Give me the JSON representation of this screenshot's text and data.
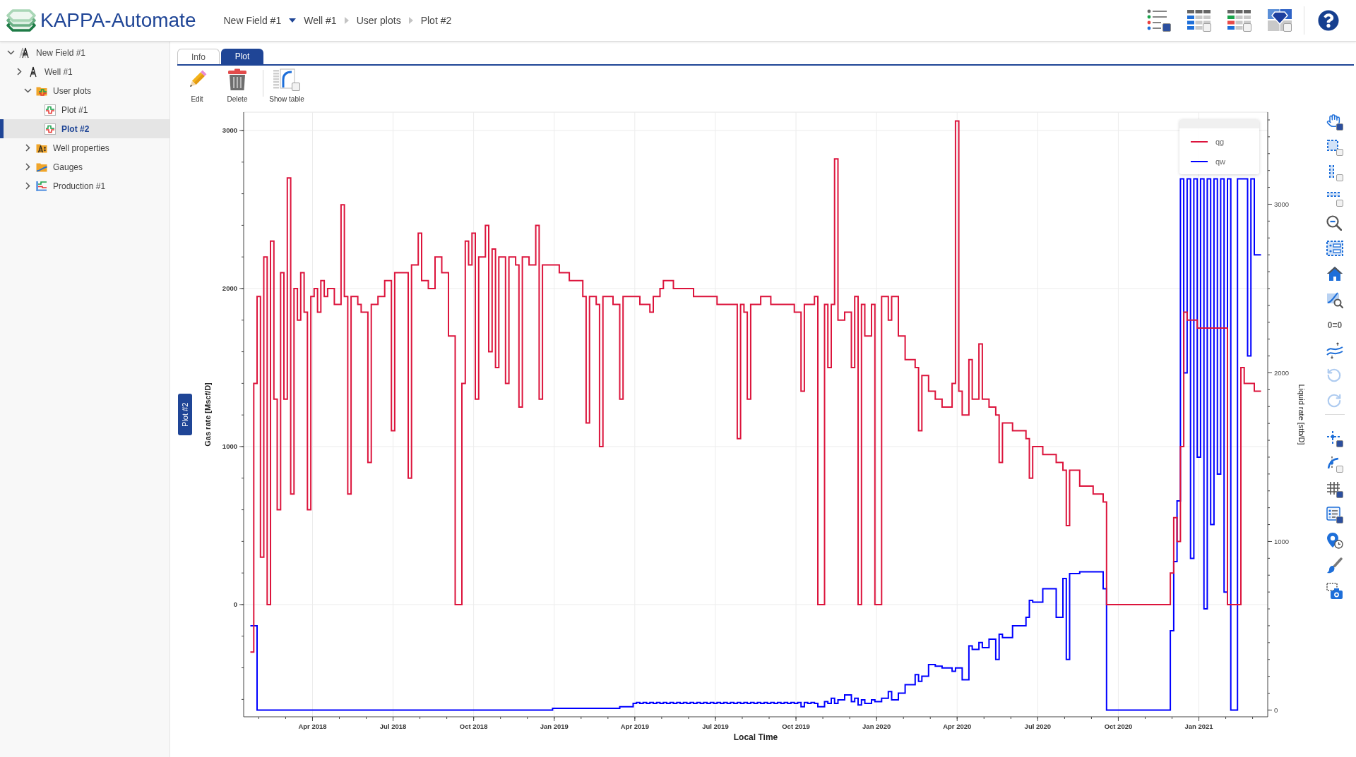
{
  "header": {
    "app_name": "KAPPA-Automate",
    "breadcrumbs": [
      {
        "label": "New Field #1",
        "kind": "dropdown"
      },
      {
        "label": "Well #1",
        "kind": "link"
      },
      {
        "label": "User plots",
        "kind": "link"
      },
      {
        "label": "Plot #2",
        "kind": "current"
      }
    ],
    "view_buttons": [
      {
        "on": true
      },
      {
        "on": false
      },
      {
        "on": false
      },
      {
        "on": false
      }
    ]
  },
  "tree": [
    {
      "label": "New Field #1",
      "kind": "field",
      "expanded": true,
      "selected": false,
      "children": [
        {
          "label": "Well #1",
          "kind": "well",
          "expanded": false,
          "selected": false,
          "children": [
            {
              "label": "User plots",
              "kind": "plotfolder",
              "expanded": true,
              "selected": false,
              "children": [
                {
                  "label": "Plot #1",
                  "kind": "plot",
                  "selected": false
                },
                {
                  "label": "Plot #2",
                  "kind": "plot",
                  "selected": true
                }
              ]
            },
            {
              "label": "Well properties",
              "kind": "propfolder",
              "expanded": false,
              "selected": false
            },
            {
              "label": "Gauges",
              "kind": "gaugefolder",
              "expanded": false,
              "selected": false
            },
            {
              "label": "Production #1",
              "kind": "production",
              "expanded": false,
              "selected": false
            }
          ]
        }
      ]
    }
  ],
  "tabs": [
    {
      "label": "Info",
      "selected": false
    },
    {
      "label": "Plot",
      "selected": true
    }
  ],
  "toolbar": [
    [
      {
        "label": "Edit",
        "kind": "action"
      },
      {
        "label": "Delete",
        "kind": "action"
      }
    ],
    [
      {
        "label": "Show table",
        "kind": "toggle",
        "on": false
      }
    ]
  ],
  "plot": {
    "side_tab": "Plot #2",
    "chart_data": {
      "type": "line",
      "xlabel": "Local Time",
      "ylabel": "Gas rate [Mscf/D]",
      "y2label": "Liquid rate [stb/D]",
      "grid": true,
      "ylim": [
        -710,
        3116
      ],
      "yticks": [
        0,
        1000,
        2000,
        3000
      ],
      "y2lim": [
        -40,
        3546
      ],
      "y2ticks": [
        0,
        1000,
        2000,
        3000
      ],
      "categories": [
        null,
        null,
        null,
        null,
        null,
        null,
        null,
        null,
        null,
        null,
        null,
        null,
        null,
        null,
        null,
        null,
        null,
        null,
        null,
        null,
        "Apr 2018",
        null,
        null,
        null,
        null,
        null,
        null,
        null,
        null,
        null,
        null,
        null,
        null,
        null,
        null,
        null,
        null,
        null,
        null,
        null,
        null,
        null,
        null,
        null,
        "Jul 2018",
        null,
        null,
        null,
        null,
        null,
        null,
        null,
        null,
        null,
        null,
        null,
        null,
        null,
        null,
        null,
        null,
        null,
        null,
        null,
        null,
        null,
        null,
        null,
        "Oct 2018",
        null,
        null,
        null,
        null,
        null,
        null,
        null,
        null,
        null,
        null,
        null,
        null,
        null,
        null,
        null,
        null,
        null,
        null,
        null,
        null,
        null,
        null,
        null,
        "Jan 2019",
        null,
        null,
        null,
        null,
        null,
        null,
        null,
        null,
        null,
        null,
        null,
        null,
        null,
        null,
        null,
        null,
        null,
        null,
        null,
        null,
        null,
        null,
        null,
        "Apr 2019",
        null,
        null,
        null,
        null,
        null,
        null,
        null,
        null,
        null,
        null,
        null,
        null,
        null,
        null,
        null,
        null,
        null,
        null,
        null,
        null,
        null,
        null,
        null,
        "Jul 2019",
        null,
        null,
        null,
        null,
        null,
        null,
        null,
        null,
        null,
        null,
        null,
        null,
        null,
        null,
        null,
        null,
        null,
        null,
        null,
        null,
        null,
        null,
        null,
        "Oct 2019",
        null,
        null,
        null,
        null,
        null,
        null,
        null,
        null,
        null,
        null,
        null,
        null,
        null,
        null,
        null,
        null,
        null,
        null,
        null,
        null,
        null,
        null,
        null,
        "Jan 2020",
        null,
        null,
        null,
        null,
        null,
        null,
        null,
        null,
        null,
        null,
        null,
        null,
        null,
        null,
        null,
        null,
        null,
        null,
        null,
        null,
        null,
        null,
        null,
        "Apr 2020",
        null,
        null,
        null,
        null,
        null,
        null,
        null,
        null,
        null,
        null,
        null,
        null,
        null,
        null,
        null,
        null,
        null,
        null,
        null,
        null,
        null,
        null,
        null,
        "Jul 2020",
        null,
        null,
        null,
        null,
        null,
        null,
        null,
        null,
        null,
        null,
        null,
        null,
        null,
        null,
        null,
        null,
        null,
        null,
        null,
        null,
        null,
        null,
        null,
        "Oct 2020",
        null,
        null,
        null,
        null,
        null,
        null,
        null,
        null,
        null,
        null,
        null,
        null,
        null,
        null,
        null,
        null,
        null,
        null,
        null,
        null,
        null,
        null,
        null,
        "Jan 2021",
        null,
        null,
        null,
        null,
        null,
        null,
        null,
        null,
        null,
        null,
        null,
        null,
        null,
        null,
        null,
        null,
        null,
        null,
        null,
        null
      ],
      "series": [
        {
          "name": "qg",
          "color": "#dc143c",
          "values": [
            null,
            null,
            -300,
            1400,
            1950,
            300,
            2200,
            0,
            2300,
            1300,
            600,
            2100,
            1300,
            2700,
            700,
            2000,
            1800,
            2100,
            1850,
            600,
            1950,
            2000,
            1850,
            2050,
            1950,
            2000,
            2000,
            1900,
            1900,
            2530,
            1950,
            700,
            1950,
            1950,
            1900,
            1850,
            1850,
            900,
            1900,
            1900,
            1950,
            1950,
            2050,
            2050,
            1100,
            2100,
            2100,
            2100,
            2100,
            800,
            2150,
            2150,
            2350,
            2050,
            2050,
            2000,
            2000,
            2200,
            2200,
            2100,
            2100,
            1700,
            1700,
            0,
            0,
            1400,
            2300,
            2150,
            2350,
            1300,
            2200,
            2200,
            2400,
            1600,
            2250,
            1500,
            2200,
            2200,
            1400,
            2200,
            2200,
            2150,
            1250,
            2200,
            2200,
            2150,
            2150,
            2400,
            1300,
            2150,
            2150,
            2150,
            2150,
            2150,
            2100,
            2100,
            2100,
            2050,
            2050,
            2050,
            2050,
            1950,
            1150,
            1950,
            1950,
            1900,
            1000,
            1950,
            1950,
            1950,
            1900,
            1900,
            1300,
            1950,
            1950,
            1950,
            1950,
            1950,
            1900,
            1900,
            1900,
            1850,
            1950,
            1950,
            2000,
            2050,
            2050,
            2050,
            2000,
            2000,
            2000,
            2000,
            2000,
            2000,
            1950,
            1950,
            1950,
            1950,
            1950,
            1950,
            1950,
            1900,
            1900,
            1900,
            1900,
            1900,
            1900,
            1050,
            1900,
            1850,
            1300,
            1900,
            1900,
            1900,
            1950,
            1950,
            1950,
            1900,
            1900,
            1900,
            1900,
            1900,
            1900,
            1900,
            1850,
            1850,
            1350,
            1900,
            1900,
            1900,
            1950,
            0,
            0,
            1900,
            1500,
            1900,
            2820,
            1800,
            1800,
            1850,
            1850,
            1500,
            1950,
            0,
            1900,
            1700,
            1700,
            1900,
            0,
            0,
            1950,
            1950,
            1800,
            1950,
            1950,
            1700,
            1700,
            1550,
            1550,
            1550,
            1500,
            1100,
            1450,
            1450,
            1350,
            1350,
            1300,
            1300,
            1250,
            1250,
            1250,
            1400,
            3060,
            1350,
            1200,
            1200,
            1550,
            1300,
            1300,
            1650,
            1300,
            1300,
            1250,
            1250,
            1200,
            900,
            1150,
            1150,
            1150,
            1100,
            1100,
            1100,
            1100,
            1050,
            800,
            1000,
            1000,
            1000,
            950,
            950,
            950,
            950,
            900,
            900,
            850,
            500,
            850,
            850,
            850,
            750,
            750,
            750,
            750,
            700,
            700,
            700,
            650,
            0,
            0,
            0,
            0,
            0,
            0,
            0,
            0,
            0,
            0,
            0,
            0,
            0,
            0,
            0,
            0,
            0,
            0,
            0,
            200,
            550,
            400,
            1000,
            1850,
            1800,
            1800,
            1800,
            1750,
            1750,
            1750,
            1750,
            1750,
            1750,
            1750,
            1750,
            1750,
            0,
            0,
            0,
            0,
            1500,
            1400,
            1400,
            1400,
            1350,
            1350,
            null,
            null
          ]
        },
        {
          "name": "qw",
          "color": "#0000ff",
          "axis": "y2",
          "values": [
            null,
            null,
            500,
            500,
            0,
            0,
            0,
            0,
            0,
            0,
            0,
            0,
            0,
            0,
            0,
            0,
            0,
            0,
            0,
            0,
            0,
            0,
            0,
            0,
            0,
            0,
            0,
            0,
            0,
            0,
            0,
            0,
            0,
            0,
            0,
            0,
            0,
            0,
            0,
            0,
            0,
            0,
            0,
            0,
            0,
            0,
            0,
            0,
            0,
            0,
            0,
            0,
            0,
            0,
            0,
            0,
            0,
            0,
            0,
            0,
            0,
            0,
            0,
            0,
            0,
            0,
            0,
            0,
            0,
            0,
            0,
            0,
            0,
            0,
            0,
            0,
            0,
            0,
            0,
            0,
            0,
            0,
            0,
            0,
            0,
            0,
            0,
            0,
            0,
            0,
            0,
            0,
            10,
            10,
            10,
            10,
            10,
            10,
            10,
            10,
            10,
            10,
            10,
            10,
            10,
            10,
            10,
            10,
            10,
            10,
            10,
            10,
            20,
            20,
            20,
            20,
            40,
            45,
            40,
            45,
            40,
            45,
            40,
            45,
            40,
            45,
            40,
            45,
            40,
            45,
            40,
            45,
            40,
            45,
            40,
            45,
            40,
            45,
            40,
            45,
            40,
            45,
            40,
            45,
            40,
            45,
            40,
            45,
            40,
            45,
            40,
            45,
            40,
            45,
            40,
            45,
            40,
            45,
            40,
            45,
            40,
            45,
            40,
            45,
            40,
            45,
            20,
            45,
            40,
            45,
            40,
            20,
            20,
            50,
            40,
            70,
            40,
            60,
            60,
            90,
            90,
            50,
            70,
            30,
            60,
            40,
            40,
            60,
            50,
            50,
            70,
            70,
            110,
            60,
            60,
            100,
            100,
            150,
            150,
            150,
            210,
            170,
            200,
            200,
            270,
            270,
            260,
            260,
            250,
            250,
            250,
            230,
            250,
            250,
            180,
            180,
            380,
            360,
            360,
            400,
            370,
            370,
            420,
            420,
            300,
            450,
            430,
            430,
            430,
            500,
            500,
            500,
            500,
            550,
            650,
            640,
            640,
            640,
            720,
            720,
            720,
            720,
            550,
            550,
            780,
            300,
            810,
            810,
            810,
            820,
            820,
            820,
            820,
            820,
            820,
            820,
            720,
            0,
            0,
            0,
            0,
            0,
            0,
            0,
            0,
            0,
            0,
            0,
            0,
            0,
            0,
            0,
            0,
            0,
            0,
            0,
            470,
            880,
            1240,
            3150,
            2000,
            3150,
            900,
            3150,
            1500,
            3150,
            600,
            3150,
            1100,
            3150,
            1400,
            3150,
            700,
            3150,
            0,
            0,
            3150,
            3150,
            3150,
            2100,
            3150,
            2700,
            2700,
            null,
            null
          ]
        }
      ]
    }
  },
  "plot_tools": [
    [
      {
        "kind": "toggle",
        "on": true,
        "disabled": false
      },
      {
        "kind": "toggle",
        "on": false,
        "disabled": false
      },
      {
        "kind": "toggle",
        "on": false,
        "disabled": false
      },
      {
        "kind": "toggle",
        "on": false,
        "disabled": false
      },
      {
        "kind": "action",
        "disabled": false
      },
      {
        "kind": "action",
        "disabled": false
      },
      {
        "kind": "action",
        "disabled": false
      },
      {
        "kind": "action",
        "disabled": false
      },
      {
        "kind": "text",
        "label": "0=0",
        "disabled": false
      },
      {
        "kind": "action",
        "disabled": false
      },
      {
        "kind": "action",
        "disabled": true
      },
      {
        "kind": "action",
        "disabled": true
      }
    ],
    [
      {
        "kind": "toggle",
        "on": true,
        "disabled": false
      },
      {
        "kind": "toggle",
        "on": false,
        "disabled": false
      },
      {
        "kind": "toggle",
        "on": true,
        "disabled": false
      },
      {
        "kind": "toggle",
        "on": true,
        "disabled": false
      },
      {
        "kind": "action",
        "disabled": false
      },
      {
        "kind": "action",
        "disabled": false
      },
      {
        "kind": "action",
        "disabled": false
      }
    ]
  ]
}
